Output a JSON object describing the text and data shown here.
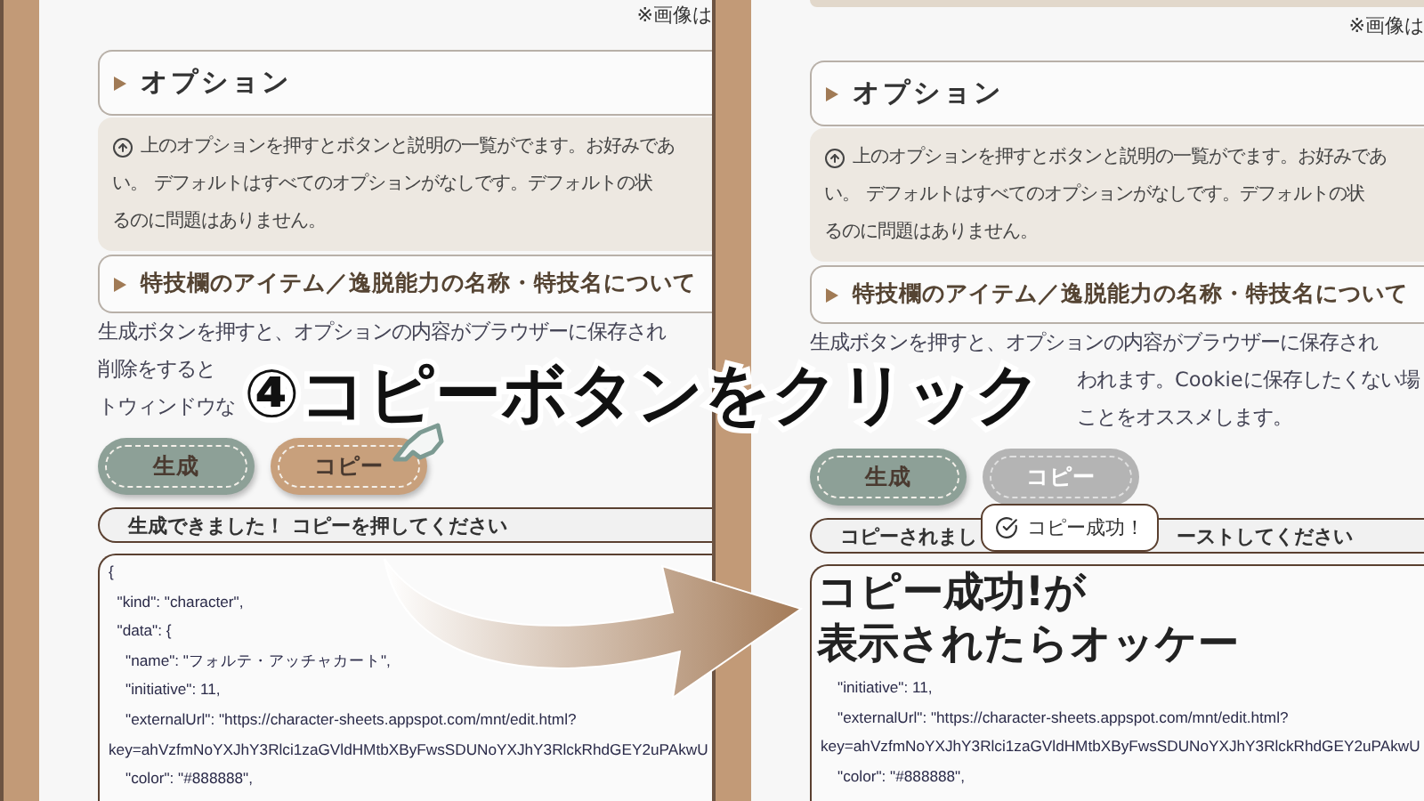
{
  "panels": [
    {
      "card_above": false,
      "note": "※画像は",
      "options": {
        "label": "オプション",
        "expanded": false
      },
      "info_lines": [
        "上のオプションを押すとボタンと説明の一覧がでます。お好みであ",
        "い。 デフォルトはすべてのオプションがなしです。デフォルトの状",
        "るのに問題はありません。"
      ],
      "special": {
        "label": "特技欄のアイテム／逸脱能力の名称・特技名について",
        "expanded": false
      },
      "paragraph_lines": [
        {
          "text": "生成ボタンを押すと、オプションの内容がブラウザーに保存され",
          "kind": "full"
        },
        {
          "text": "削除をすると",
          "kind": "head"
        },
        {
          "text": "トウィンドウな",
          "kind": "head"
        }
      ],
      "buttons": [
        {
          "label": "生成",
          "kind": "generate",
          "disabled": false
        },
        {
          "label": "コピー",
          "kind": "copy",
          "disabled": false
        }
      ],
      "status": [
        "生成できました！ コピーを押してください"
      ],
      "code_lines": [
        "{",
        "  \"kind\": \"character\",",
        "  \"data\": {",
        "    \"name\": \"フォルテ・アッチャカート\",",
        "    \"initiative\": 11,",
        "    \"externalUrl\": \"https://character-sheets.appspot.com/mnt/edit.html?",
        "key=ahVzfmNoYXJhY3Rlci1zaGVldHMtbXByFwsSDUNoYXJhY3RlckRhdGEY2uPAkwU",
        "    \"color\": \"#888888\","
      ]
    },
    {
      "card_above": true,
      "note": "※画像は",
      "options": {
        "label": "オプション",
        "expanded": false
      },
      "info_lines": [
        "上のオプションを押すとボタンと説明の一覧がでます。お好みであ",
        "い。 デフォルトはすべてのオプションがなしです。デフォルトの状",
        "るのに問題はありません。"
      ],
      "special": {
        "label": "特技欄のアイテム／逸脱能力の名称・特技名について",
        "expanded": false
      },
      "paragraph_lines": [
        {
          "text": "生成ボタンを押すと、オプションの内容がブラウザーに保存され",
          "kind": "full"
        },
        {
          "text": "われます。Cookieに保存したくない場",
          "kind": "tail"
        },
        {
          "text": "ことをオススメします。",
          "kind": "tail"
        }
      ],
      "buttons": [
        {
          "label": "生成",
          "kind": "generate",
          "disabled": false
        },
        {
          "label": "コピー",
          "kind": "copy",
          "disabled": true
        }
      ],
      "status": [
        "コピーされまし",
        "ーストしてください"
      ],
      "code_lines": [
        "    \"initiative\": 11,",
        "    \"externalUrl\": \"https://character-sheets.appspot.com/mnt/edit.html?",
        "key=ahVzfmNoYXJhY3Rlci1zaGVldHMtbXByFwsSDUNoYXJhY3RlckRhdGEY2uPAkwU",
        "    \"color\": \"#888888\","
      ],
      "callout_lines": [
        "コピー成功!が",
        "表示されたらオッケー"
      ],
      "toast": {
        "text": "コピー成功！"
      }
    }
  ],
  "step_caption": "④コピーボタンをクリック"
}
